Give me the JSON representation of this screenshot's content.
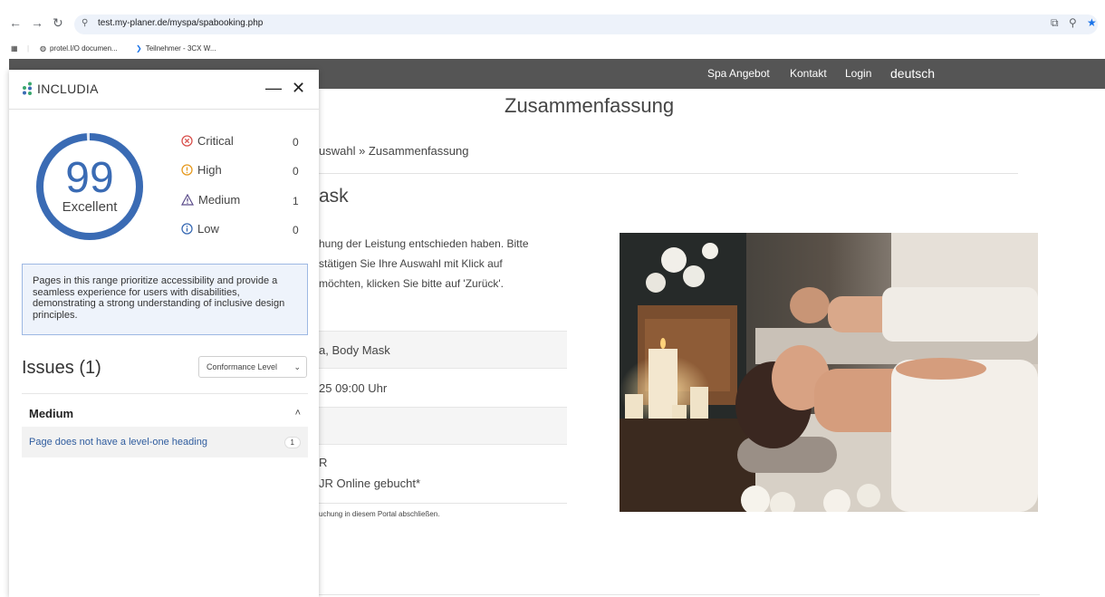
{
  "browser": {
    "url": "test.my-planer.de/myspa/spabooking.php",
    "bookmarks": [
      "protel.I/O documen...",
      "Teilnehmer - 3CX W..."
    ]
  },
  "site": {
    "nav": [
      "Spa Angebot",
      "Kontakt",
      "Login",
      "deutsch"
    ],
    "page_title": "Zusammenfassung",
    "breadcrumb": "uswahl » Zusammenfassung",
    "section_heading": "ask",
    "description": [
      "hung der Leistung entschieden haben. Bitte",
      "stätigen Sie Ihre Auswahl mit Klick auf",
      "möchten, klicken Sie bitte auf 'Zurück'."
    ],
    "rows": [
      "a, Body Mask",
      "25 09:00 Uhr",
      ""
    ],
    "price_line_1": "R",
    "price_line_2": "JR  Online gebucht*",
    "fine_print": "uchung in diesem Portal abschließen."
  },
  "panel": {
    "brand": "INCLUDIA",
    "score": "99",
    "score_label": "Excellent",
    "score_fraction": 0.99,
    "severities": [
      {
        "label": "Critical",
        "count": "0",
        "icon": "critical-x-icon",
        "color": "#d9534f"
      },
      {
        "label": "High",
        "count": "0",
        "icon": "high-exclamation-icon",
        "color": "#e69b22"
      },
      {
        "label": "Medium",
        "count": "1",
        "icon": "medium-warning-icon",
        "color": "#5b4c8a"
      },
      {
        "label": "Low",
        "count": "0",
        "icon": "low-info-icon",
        "color": "#3a6bb4"
      }
    ],
    "info": "Pages in this range prioritize accessibility and provide a seamless experience for users with disabilities, demonstrating a strong understanding of inclusive design principles.",
    "issues_title": "Issues (1)",
    "conformance_label": "Conformance Level",
    "group_title": "Medium",
    "issue_text": "Page does not have a level-one heading",
    "issue_count": "1",
    "accent": "#3a6bb4"
  }
}
